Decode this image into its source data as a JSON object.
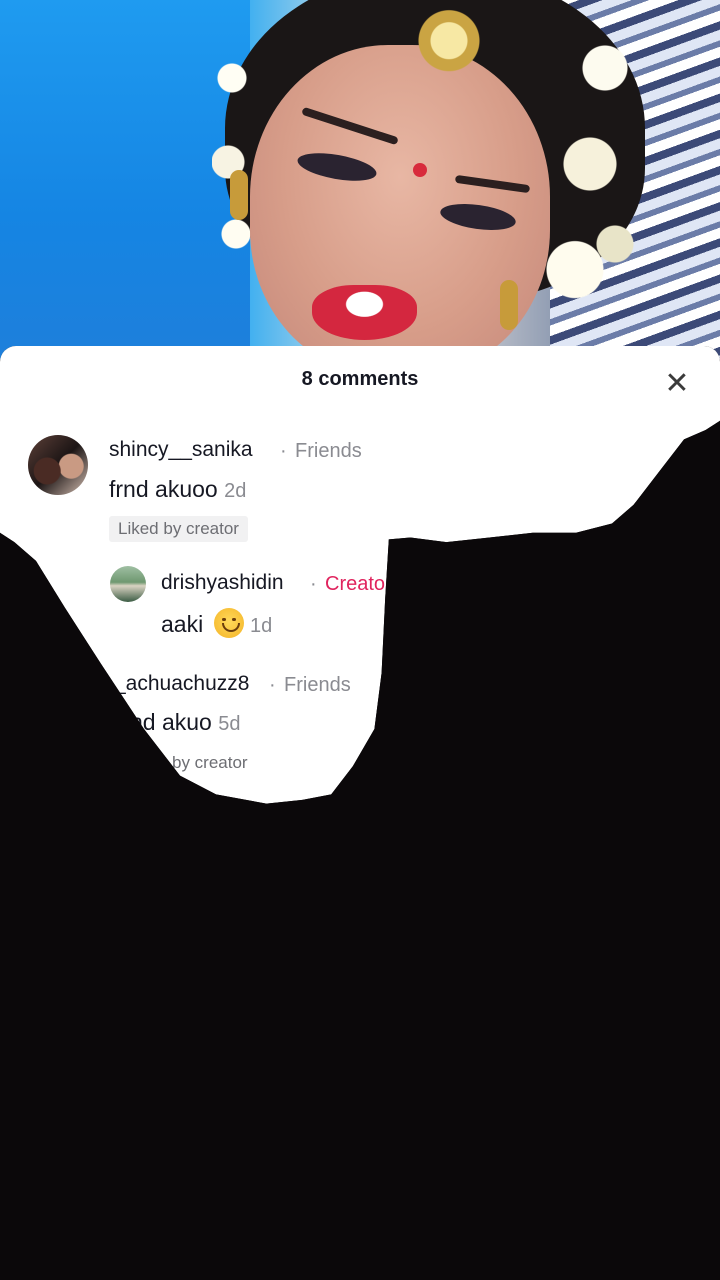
{
  "video": {
    "description_icon": "video-frame"
  },
  "comments_panel": {
    "title": "8 comments",
    "close_icon": "close-icon",
    "comments": [
      {
        "username": "shincy__sanika",
        "separator": "·",
        "tag": "Friends",
        "text": "frnd akuoo",
        "time": "2d",
        "liked_badge": "Liked by creator"
      },
      {
        "username": "drishyashidin",
        "separator": "·",
        "tag": "Creato",
        "text": "aaki",
        "emoji": "smiling-face-emoji",
        "time": "1d"
      },
      {
        "username": "_achuachuzz8",
        "separator": "·",
        "tag": "Friends",
        "text": "nd akuo",
        "time": "5d",
        "liked_badge": "by creator"
      }
    ]
  },
  "colors": {
    "text_primary": "#161823",
    "text_secondary": "#8a8b91",
    "creator_accent": "#e0245e",
    "panel_bg": "#ffffff",
    "overlay_dark": "#0b080a"
  }
}
